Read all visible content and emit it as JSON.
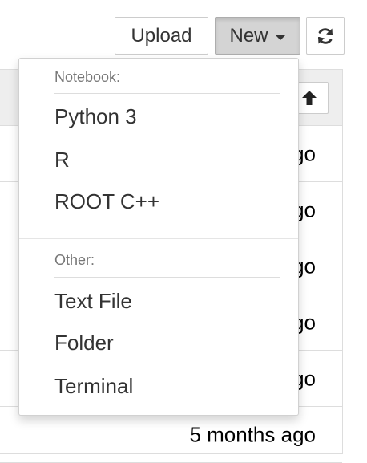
{
  "toolbar": {
    "upload_label": "Upload",
    "new_label": "New",
    "refresh_icon": "refresh-icon"
  },
  "file_list": {
    "sort_icon": "arrow-up-icon",
    "rows": [
      {
        "time": "...ago"
      },
      {
        "time": "...ago"
      },
      {
        "time": "...ago"
      },
      {
        "time": "...ago"
      },
      {
        "time": "...ago"
      },
      {
        "time": "5 months ago"
      }
    ]
  },
  "new_menu": {
    "notebook_header": "Notebook:",
    "notebook_items": [
      "Python 3",
      "R",
      "ROOT C++"
    ],
    "other_header": "Other:",
    "other_items": [
      "Text File",
      "Folder",
      "Terminal"
    ]
  }
}
